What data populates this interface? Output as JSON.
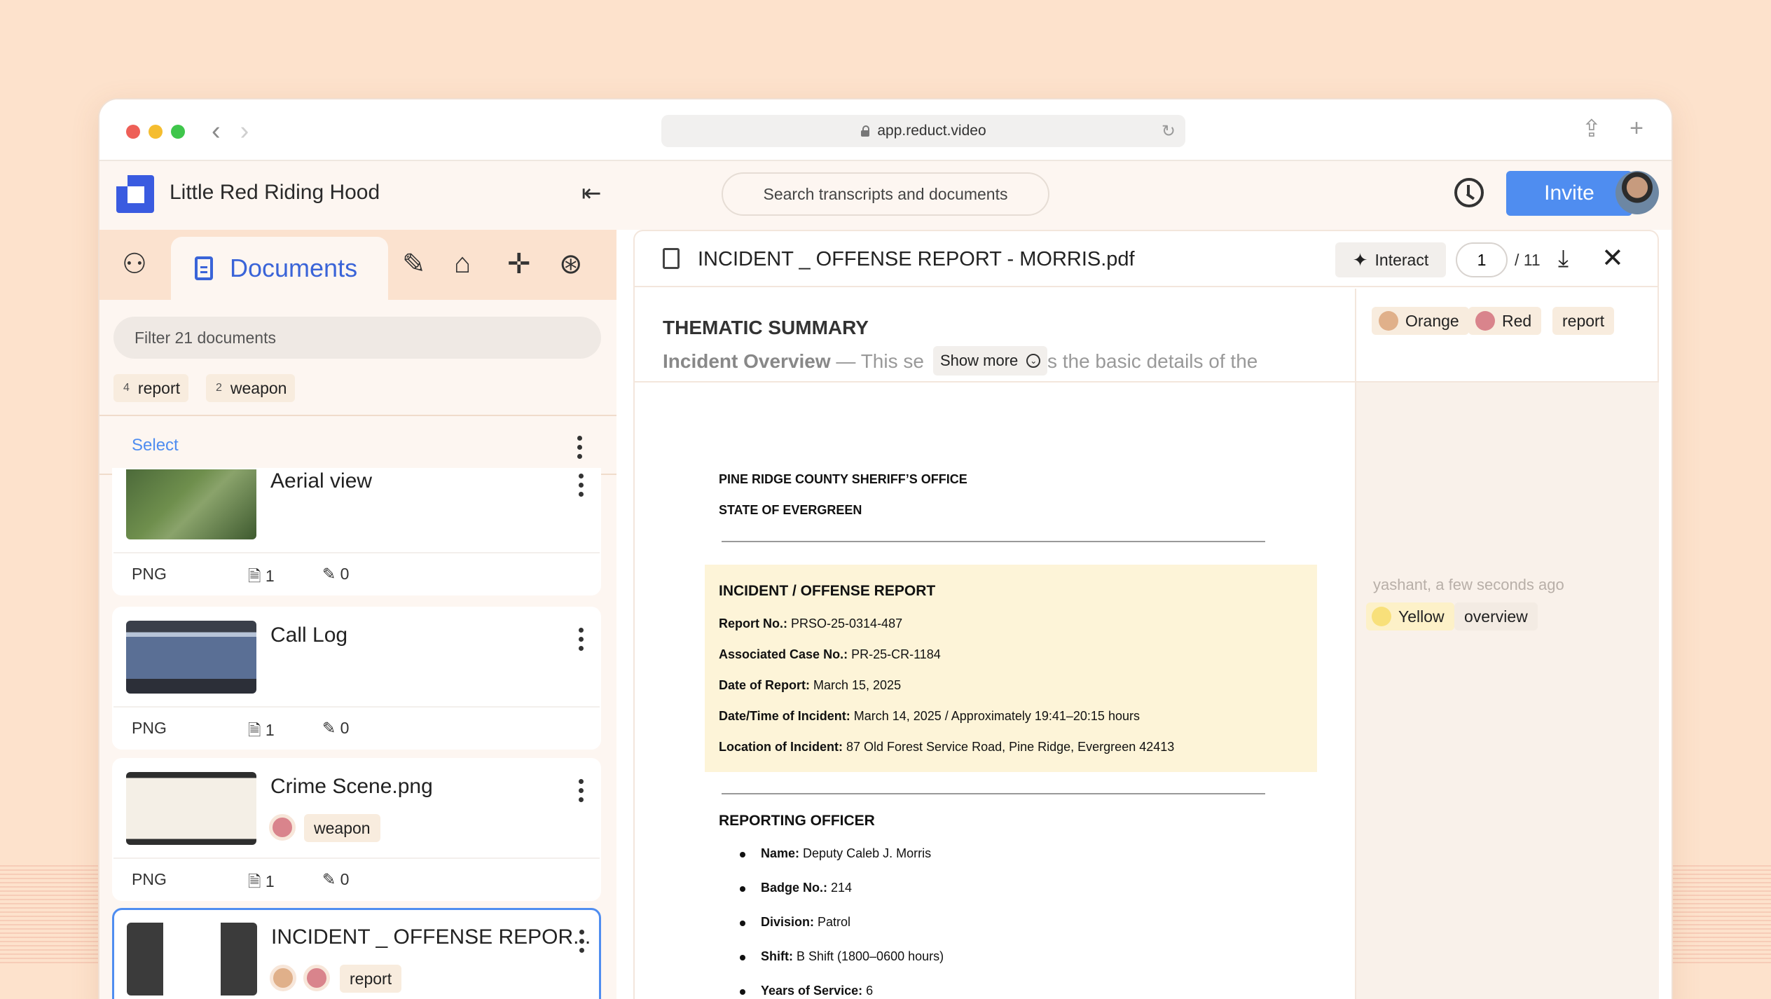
{
  "browser": {
    "url": "app.reduct.video"
  },
  "app": {
    "project_title": "Little Red Riding Hood",
    "search_placeholder": "Search transcripts and documents",
    "invite_label": "Invite"
  },
  "left_panel": {
    "active_tab": "Documents",
    "filter_placeholder": "Filter 21 documents",
    "tag_filters": [
      {
        "count": "4",
        "label": "report"
      },
      {
        "count": "2",
        "label": "weapon"
      }
    ],
    "select_label": "Select",
    "documents": [
      {
        "title": "Aerial view",
        "type": "PNG",
        "pages": "1",
        "clips": "0"
      },
      {
        "title": "Call Log",
        "type": "PNG",
        "pages": "1",
        "clips": "0"
      },
      {
        "title": "Crime Scene.png",
        "type": "PNG",
        "pages": "1",
        "clips": "0",
        "tag": "weapon"
      },
      {
        "title": "INCIDENT _ OFFENSE REPOR...",
        "tag": "report"
      }
    ]
  },
  "viewer": {
    "file_name": "INCIDENT _ OFFENSE REPORT - MORRIS.pdf",
    "interact_label": "Interact",
    "page_current": "1",
    "page_total": "/ 11",
    "summary_title": "THEMATIC SUMMARY",
    "summary_lead": "Incident Overview",
    "summary_text_a": " — This se",
    "summary_text_b": "s the basic details of the",
    "show_more_label": "Show more",
    "side_tags": {
      "orange": "Orange",
      "red": "Red",
      "report": "report"
    },
    "note": {
      "meta": "yashant, a few seconds ago",
      "yellow": "Yellow",
      "tag": "overview"
    },
    "pdf": {
      "office": "PINE RIDGE COUNTY SHERIFF’S OFFICE",
      "state": "STATE OF EVERGREEN",
      "heading": "INCIDENT / OFFENSE REPORT",
      "report_no_label": "Report No.:",
      "report_no": " PRSO-25-0314-487",
      "case_no_label": "Associated Case No.:",
      "case_no": " PR-25-CR-1184",
      "date_label": "Date of Report:",
      "date": " March 15, 2025",
      "datetime_label": "Date/Time of Incident:",
      "datetime": " March 14, 2025 / Approximately 19:41–20:15 hours",
      "location_label": "Location of Incident:",
      "location": " 87 Old Forest Service Road, Pine Ridge, Evergreen 42413",
      "officer_heading": "REPORTING OFFICER",
      "name_label": "Name:",
      "name": " Deputy Caleb J. Morris",
      "badge_label": "Badge No.:",
      "badge": " 214",
      "division_label": "Division:",
      "division": " Patrol",
      "shift_label": "Shift:",
      "shift": " B Shift (1800–0600 hours)",
      "years_label": "Years of Service:",
      "years": " 6"
    }
  },
  "colors": {
    "accent": "#4f8df0",
    "brand": "#3a5be0",
    "orange_dot": "#e0b08a",
    "red_dot": "#d9848c",
    "yellow_dot": "#f8e07a"
  }
}
